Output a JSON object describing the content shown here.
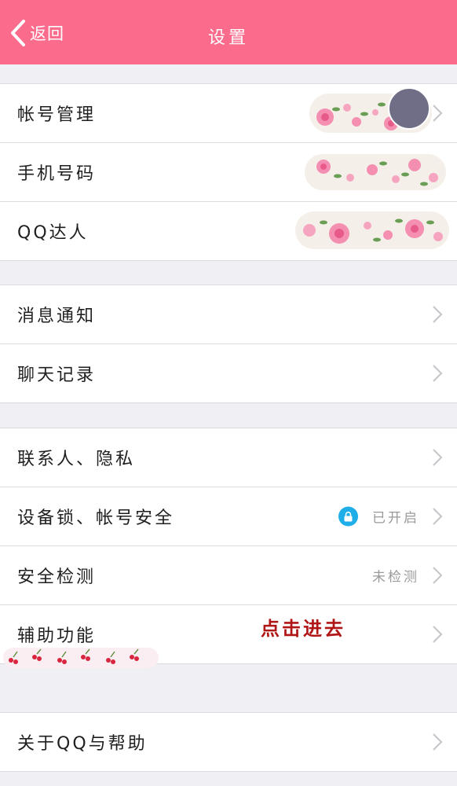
{
  "navbar": {
    "back_label": "返回",
    "title": "设置"
  },
  "groups": [
    {
      "items": [
        {
          "label": "帐号管理"
        },
        {
          "label": "手机号码"
        },
        {
          "label": "QQ达人"
        }
      ]
    },
    {
      "items": [
        {
          "label": "消息通知"
        },
        {
          "label": "聊天记录"
        }
      ]
    },
    {
      "items": [
        {
          "label": "联系人、隐私"
        },
        {
          "label": "设备锁、帐号安全",
          "value": "已开启"
        },
        {
          "label": "安全检测",
          "value": "未检测"
        },
        {
          "label": "辅助功能"
        }
      ]
    },
    {
      "items": [
        {
          "label": "关于QQ与帮助"
        }
      ]
    }
  ],
  "annotation": "点击进去",
  "colors": {
    "accent": "#fb6b8c",
    "lock": "#1faee8",
    "annotation": "#b01616"
  }
}
